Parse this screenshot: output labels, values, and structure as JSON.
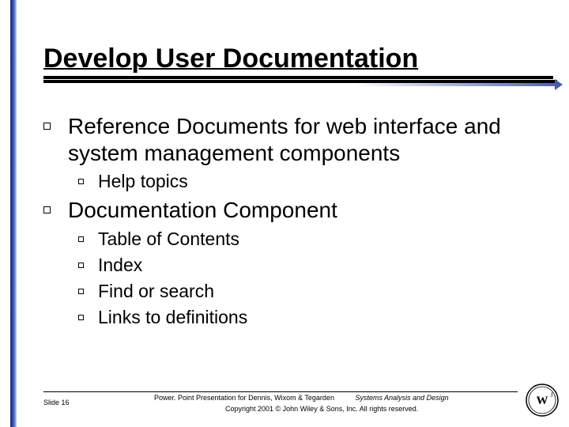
{
  "title": "Develop User Documentation",
  "bullets": {
    "item1": "Reference Documents for web interface and system management components",
    "item1_sub1": "Help topics",
    "item2": "Documentation Component",
    "item2_sub1": "Table of Contents",
    "item2_sub2": "Index",
    "item2_sub3": "Find or search",
    "item2_sub4": "Links to definitions"
  },
  "footer": {
    "slide": "Slide 16",
    "line1a": "Power. Point Presentation for Dennis, Wixom & Tegarden",
    "line1b": "Systems Analysis and Design",
    "line2": "Copyright 2001 © John Wiley & Sons, Inc.  All rights reserved."
  }
}
